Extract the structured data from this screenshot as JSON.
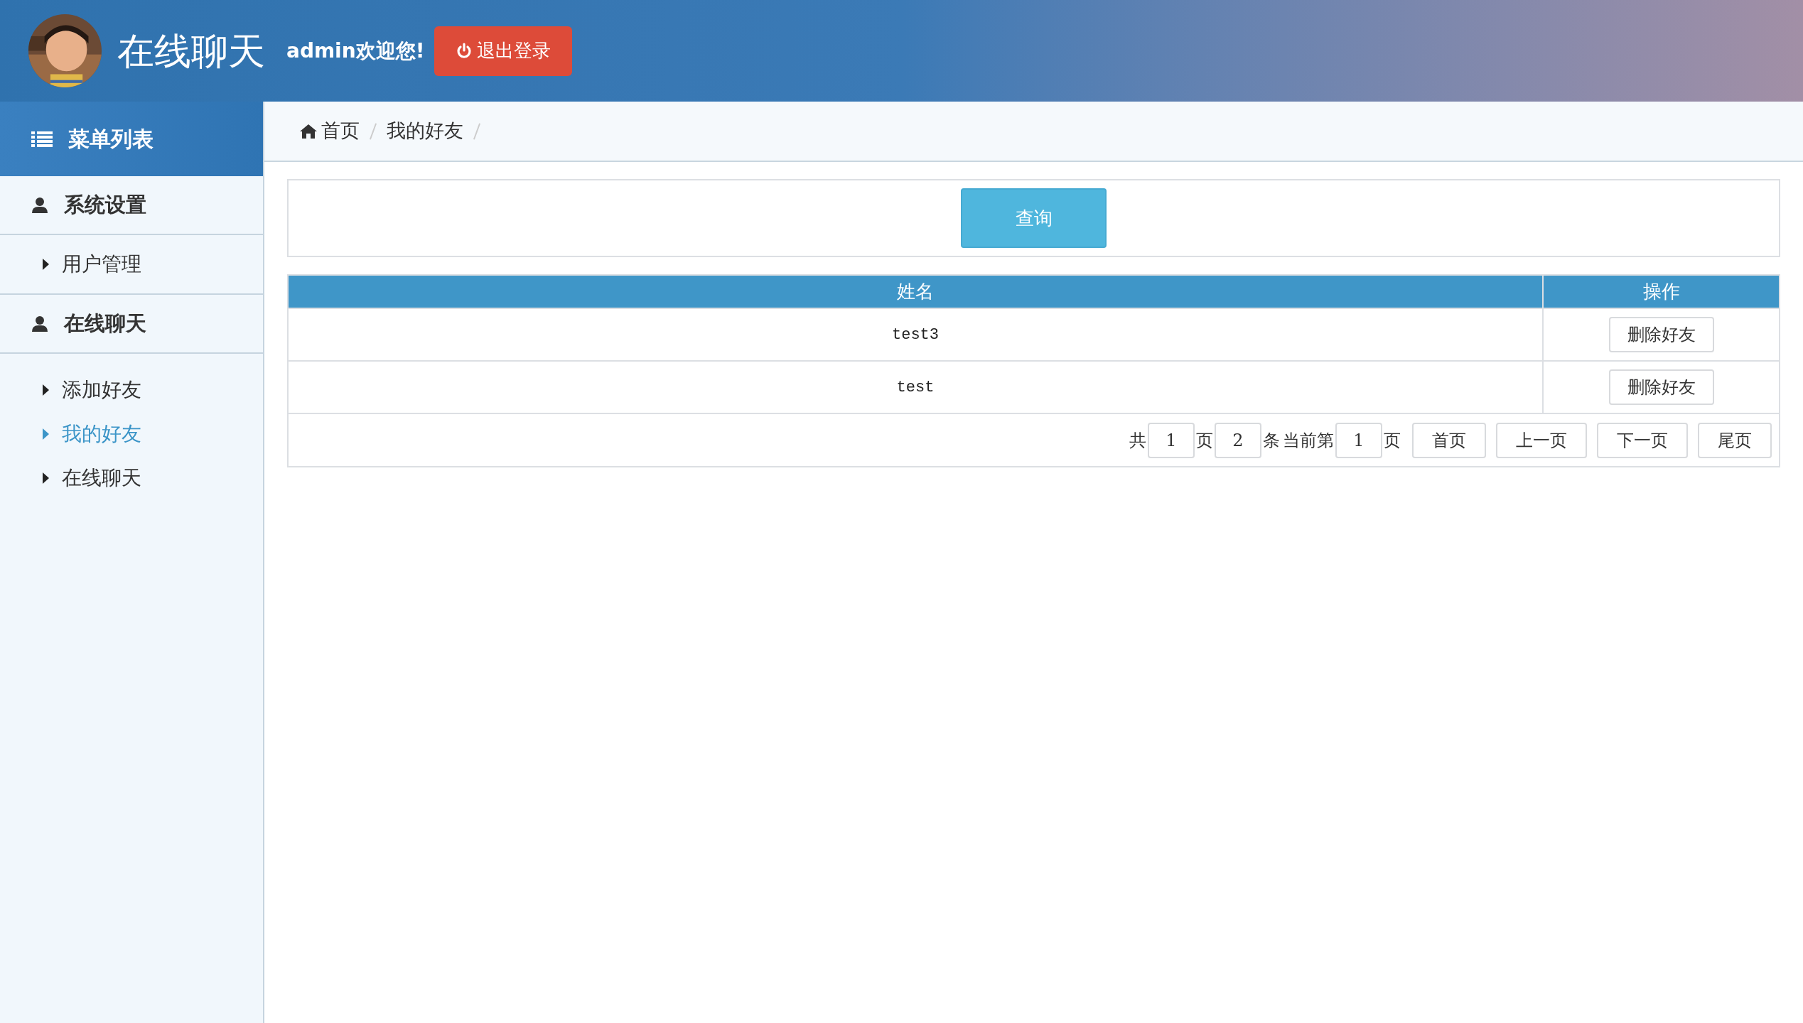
{
  "header": {
    "title": "在线聊天",
    "welcome": "admin欢迎您!",
    "logout_button": "退出登录"
  },
  "sidebar": {
    "title": "菜单列表",
    "groups": [
      {
        "label": "系统设置",
        "items": [
          {
            "label": "用户管理",
            "selected": false
          }
        ]
      },
      {
        "label": "在线聊天",
        "items": [
          {
            "label": "添加好友",
            "selected": false
          },
          {
            "label": "我的好友",
            "selected": true
          },
          {
            "label": "在线聊天",
            "selected": false
          }
        ]
      }
    ]
  },
  "breadcrumb": [
    {
      "label": "首页",
      "kind": "home"
    },
    {
      "label": "我的好友",
      "kind": "page"
    }
  ],
  "search_panel": {
    "button": "查询"
  },
  "table": {
    "columns": [
      "姓名",
      "操作"
    ],
    "rows": [
      {
        "name": "test3",
        "action": "删除好友"
      },
      {
        "name": "test",
        "action": "删除好友"
      }
    ]
  },
  "pagination": [
    {
      "kind": "text",
      "text": "共"
    },
    {
      "kind": "field",
      "text": "1"
    },
    {
      "kind": "text",
      "text": "页"
    },
    {
      "kind": "field",
      "text": "2"
    },
    {
      "kind": "text",
      "text": "条"
    },
    {
      "kind": "text",
      "text": "当前第"
    },
    {
      "kind": "field",
      "text": "1"
    },
    {
      "kind": "text",
      "text": "页"
    },
    {
      "kind": "button",
      "text": "首页"
    },
    {
      "kind": "button",
      "text": "上一页"
    },
    {
      "kind": "button",
      "text": "下一页"
    },
    {
      "kind": "button",
      "text": "尾页"
    }
  ]
}
